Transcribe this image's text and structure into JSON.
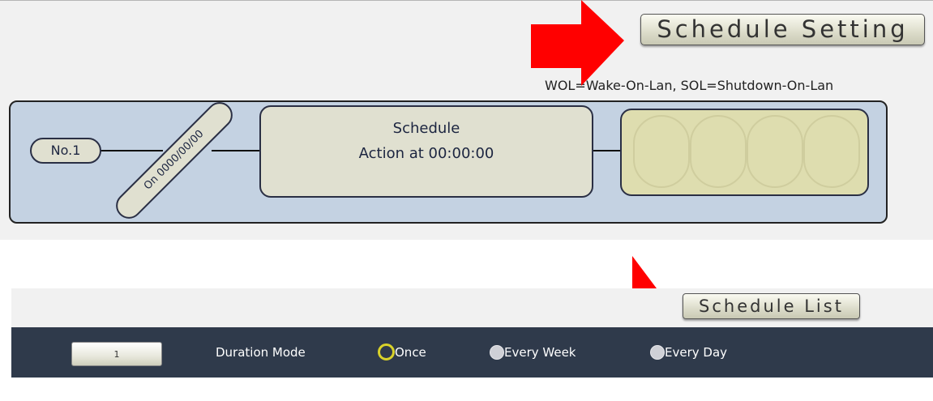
{
  "header": {
    "schedule_setting_label": "Schedule Setting",
    "legend": "WOL=Wake-On-Lan, SOL=Shutdown-On-Lan"
  },
  "diagram": {
    "number_label": "No.1",
    "date_label": "On 0000/00/00",
    "schedule_title": "Schedule",
    "action_label": "Action at 00:00:00",
    "slot_count": 4
  },
  "list": {
    "schedule_list_label": "Schedule List",
    "number_value": "1",
    "duration_mode_label": "Duration Mode",
    "duration_options": [
      "Once",
      "Every Week",
      "Every Day"
    ],
    "selected_option": "Once"
  },
  "colors": {
    "arrow": "#ff0000",
    "diagram_background": "#c4d2e2",
    "pill_fill": "#e0e0d0",
    "slots_fill": "#deddaf",
    "bar_background": "#2f3a4b",
    "selected_radio": "#d9d22a"
  },
  "icons": [
    "red-arrow-annotation",
    "radio-selected-icon",
    "radio-unselected-icon"
  ]
}
